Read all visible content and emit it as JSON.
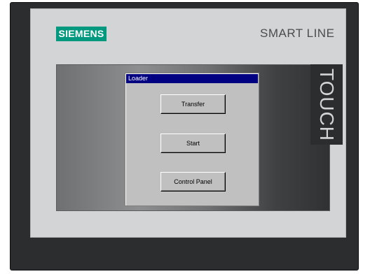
{
  "device": {
    "brand": "SIEMENS",
    "model": "SMART LINE",
    "touch_label": "TOUCH"
  },
  "dialog": {
    "title": "Loader",
    "buttons": [
      {
        "label": "Transfer"
      },
      {
        "label": "Start"
      },
      {
        "label": "Control Panel"
      }
    ]
  },
  "colors": {
    "brand": "#00997f",
    "titlebar": "#000080",
    "bezel": "#d2d4d5",
    "frame": "#2b2d2f"
  }
}
